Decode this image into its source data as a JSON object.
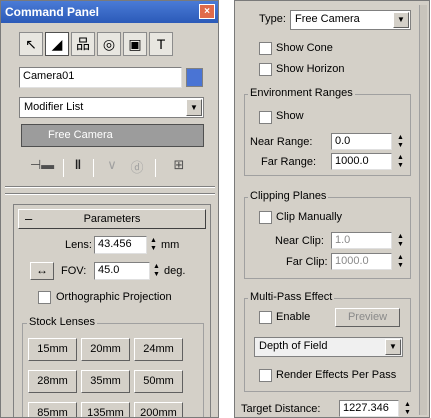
{
  "left_panel": {
    "title": "Command Panel",
    "close_glyph": "×",
    "tabs": [
      {
        "name": "create-icon",
        "glyph": "↖"
      },
      {
        "name": "modify-icon",
        "glyph": "◢"
      },
      {
        "name": "hierarchy-icon",
        "glyph": "品"
      },
      {
        "name": "motion-icon",
        "glyph": "◎"
      },
      {
        "name": "display-icon",
        "glyph": "▣"
      },
      {
        "name": "utilities-icon",
        "glyph": "T"
      }
    ],
    "object_name": "Camera01",
    "object_color": "#4a74d4",
    "modifier_list": "Modifier List",
    "stack_item": "Free Camera",
    "toolbar_glyphs": {
      "pin": "⊣▬",
      "show_end": "‖",
      "unique": "∨",
      "remove": "ⓓ",
      "configure": "⊞"
    },
    "parameters_title": "Parameters",
    "parameters_minus": "–",
    "lens_label": "Lens:",
    "lens_value": "43.456",
    "lens_unit": "mm",
    "fov_dir_glyph": "↔",
    "fov_label": "FOV:",
    "fov_value": "45.0",
    "fov_unit": "deg.",
    "ortho_label": "Orthographic Projection",
    "stock_lenses_title": "Stock Lenses",
    "stock_lenses": [
      "15mm",
      "20mm",
      "24mm",
      "28mm",
      "35mm",
      "50mm",
      "85mm",
      "135mm",
      "200mm"
    ]
  },
  "right_panel": {
    "type_label": "Type:",
    "type_value": "Free Camera",
    "show_cone": "Show Cone",
    "show_horizon": "Show Horizon",
    "env_title": "Environment Ranges",
    "env_show": "Show",
    "near_range_label": "Near Range:",
    "near_range_value": "0.0",
    "far_range_label": "Far Range:",
    "far_range_value": "1000.0",
    "clip_title": "Clipping Planes",
    "clip_manual": "Clip Manually",
    "near_clip_label": "Near Clip:",
    "near_clip_value": "1.0",
    "far_clip_label": "Far Clip:",
    "far_clip_value": "1000.0",
    "multipass_title": "Multi-Pass Effect",
    "enable_label": "Enable",
    "preview_label": "Preview",
    "effect_value": "Depth of Field",
    "render_per_pass": "Render Effects Per Pass",
    "target_label": "Target Distance:",
    "target_value": "1227.346"
  },
  "spinner_glyphs": {
    "up": "▲",
    "down": "▼"
  },
  "dropdown_arrow": "▼"
}
